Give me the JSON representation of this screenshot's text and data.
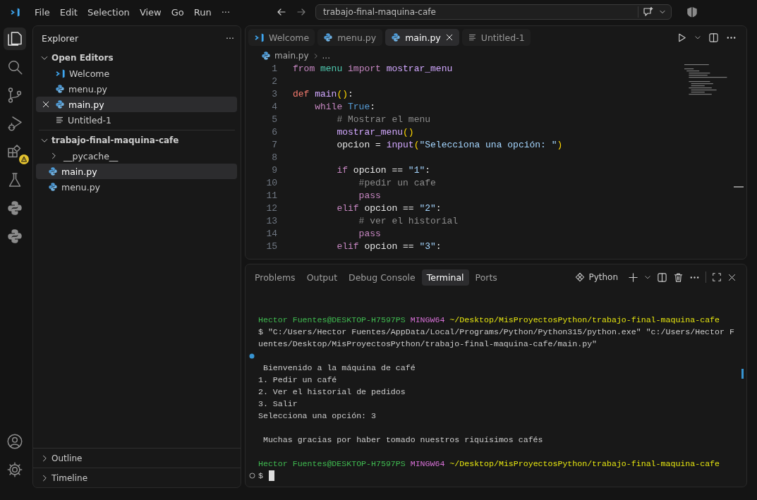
{
  "title_bar": {
    "menu": [
      "File",
      "Edit",
      "Selection",
      "View",
      "Go",
      "Run",
      "···"
    ],
    "command_center": "trabajo-final-maquina-cafe"
  },
  "activity_bar": [
    {
      "kind": "explorer",
      "selected": true,
      "warning": false
    },
    {
      "kind": "search",
      "selected": false,
      "warning": false
    },
    {
      "kind": "source-control",
      "selected": false,
      "warning": false
    },
    {
      "kind": "run-debug",
      "selected": false,
      "warning": false
    },
    {
      "kind": "extensions",
      "selected": false,
      "warning": true
    },
    {
      "kind": "testing",
      "selected": false,
      "warning": false
    },
    {
      "kind": "python",
      "selected": false,
      "warning": false
    },
    {
      "kind": "python",
      "selected": false,
      "warning": false
    }
  ],
  "activity_bar_bottom": [
    {
      "kind": "account"
    },
    {
      "kind": "settings"
    }
  ],
  "explorer": {
    "title": "Explorer",
    "more": "···",
    "sections": [
      {
        "label": "Open Editors",
        "expanded": true,
        "items": [
          {
            "label": "Welcome",
            "kind": "vscode",
            "selected": false
          },
          {
            "label": "menu.py",
            "kind": "python",
            "selected": false
          },
          {
            "label": "main.py",
            "kind": "python",
            "selected": true
          },
          {
            "label": "Untitled-1",
            "kind": "text",
            "selected": false
          }
        ]
      },
      {
        "label": "trabajo-final-maquina-cafe",
        "expanded": true,
        "items": [
          {
            "label": "__pycache__",
            "kind": "folder",
            "selected": false
          },
          {
            "label": "main.py",
            "kind": "python",
            "selected": true
          },
          {
            "label": "menu.py",
            "kind": "python",
            "selected": false
          }
        ]
      },
      {
        "label": "Outline",
        "expanded": false
      },
      {
        "label": "Timeline",
        "expanded": false
      }
    ]
  },
  "editor": {
    "tabs": [
      {
        "label": "Welcome",
        "kind": "vscode",
        "selected": false
      },
      {
        "label": "menu.py",
        "kind": "python",
        "selected": false
      },
      {
        "label": "main.py",
        "kind": "python",
        "selected": true
      },
      {
        "label": "Untitled-1",
        "kind": "text",
        "selected": false
      }
    ],
    "breadcrumb": [
      "main.py",
      "..."
    ],
    "lines": [
      {
        "number": "1",
        "tokens": [
          {
            "kind": "keyword",
            "text": "from "
          },
          {
            "kind": "module",
            "text": "menu "
          },
          {
            "kind": "keyword",
            "text": "import "
          },
          {
            "kind": "function",
            "text": "mostrar_menu"
          }
        ]
      },
      {
        "number": "2"
      },
      {
        "number": "3",
        "tokens": [
          {
            "kind": "def",
            "text": "def "
          },
          {
            "kind": "function",
            "text": "main"
          },
          {
            "kind": "paren",
            "text": "()"
          },
          {
            "kind": "plain",
            "text": ":"
          }
        ]
      },
      {
        "number": "4",
        "tokens": [
          {
            "kind": "keyword",
            "text": "    while "
          },
          {
            "kind": "constant",
            "text": "True"
          },
          {
            "kind": "plain",
            "text": ":"
          }
        ]
      },
      {
        "number": "5",
        "tokens": [
          {
            "kind": "comment",
            "text": "        # Mostrar el menu"
          }
        ]
      },
      {
        "number": "6",
        "tokens": [
          {
            "kind": "function",
            "text": "        mostrar_menu"
          },
          {
            "kind": "paren",
            "text": "()"
          }
        ]
      },
      {
        "number": "7",
        "tokens": [
          {
            "kind": "variable",
            "text": "        opcion = "
          },
          {
            "kind": "function",
            "text": "input"
          },
          {
            "kind": "paren",
            "text": "("
          },
          {
            "kind": "string",
            "text": "\"Selecciona una opción: \""
          },
          {
            "kind": "paren",
            "text": ")"
          }
        ]
      },
      {
        "number": "8"
      },
      {
        "number": "9",
        "tokens": [
          {
            "kind": "keyword",
            "text": "        if "
          },
          {
            "kind": "variable",
            "text": "opcion == "
          },
          {
            "kind": "string",
            "text": "\"1\""
          },
          {
            "kind": "plain",
            "text": ":"
          }
        ]
      },
      {
        "number": "10",
        "tokens": [
          {
            "kind": "comment",
            "text": "            #pedir un cafe"
          }
        ]
      },
      {
        "number": "11",
        "tokens": [
          {
            "kind": "keyword",
            "text": "            pass"
          }
        ]
      },
      {
        "number": "12",
        "tokens": [
          {
            "kind": "keyword",
            "text": "        elif "
          },
          {
            "kind": "variable",
            "text": "opcion == "
          },
          {
            "kind": "string",
            "text": "\"2\""
          },
          {
            "kind": "plain",
            "text": ":"
          }
        ]
      },
      {
        "number": "13",
        "tokens": [
          {
            "kind": "comment",
            "text": "            # ver el historial"
          }
        ]
      },
      {
        "number": "14",
        "tokens": [
          {
            "kind": "keyword",
            "text": "            pass"
          }
        ]
      },
      {
        "number": "15",
        "tokens": [
          {
            "kind": "keyword",
            "text": "        elif "
          },
          {
            "kind": "variable",
            "text": "opcion == "
          },
          {
            "kind": "string",
            "text": "\"3\""
          },
          {
            "kind": "plain",
            "text": ":"
          }
        ]
      }
    ]
  },
  "panel": {
    "tabs": [
      {
        "label": "Problems",
        "selected": false
      },
      {
        "label": "Output",
        "selected": false
      },
      {
        "label": "Debug Console",
        "selected": false
      },
      {
        "label": "Terminal",
        "selected": true
      },
      {
        "label": "Ports",
        "selected": false
      }
    ],
    "terminal_profile": "Python",
    "terminal_lines": [
      {
        "kind": "text",
        "segments": [
          {
            "kind": "user",
            "text": "Hector Fuentes@DESKTOP-H7597PS "
          },
          {
            "kind": "shell",
            "text": "MINGW64 "
          },
          {
            "kind": "path",
            "text": "~/Desktop/MisProyectosPython/trabajo-final-maquina-cafe"
          }
        ]
      },
      {
        "kind": "text",
        "segments": [
          {
            "kind": "plain",
            "text": "$ \"C:/Users/Hector Fuentes/AppData/Local/Programs/Python/Python315/python.exe\" \"c:/Users/Hector F"
          }
        ]
      },
      {
        "kind": "text",
        "segments": [
          {
            "kind": "plain",
            "text": "uentes/Desktop/MisProyectosPython/trabajo-final-maquina-cafe/main.py\""
          }
        ]
      },
      {
        "kind": "blank",
        "succeeded": true
      },
      {
        "kind": "text",
        "segments": [
          {
            "kind": "plain",
            "text": " Bienvenido a la máquina de café"
          }
        ]
      },
      {
        "kind": "text",
        "segments": [
          {
            "kind": "plain",
            "text": "1. Pedir un café"
          }
        ]
      },
      {
        "kind": "text",
        "segments": [
          {
            "kind": "plain",
            "text": "2. Ver el historial de pedidos"
          }
        ]
      },
      {
        "kind": "text",
        "segments": [
          {
            "kind": "plain",
            "text": "3. Salir"
          }
        ]
      },
      {
        "kind": "text",
        "segments": [
          {
            "kind": "plain",
            "text": "Selecciona una opción: 3"
          }
        ]
      },
      {
        "kind": "blank"
      },
      {
        "kind": "text",
        "segments": [
          {
            "kind": "plain",
            "text": " Muchas gracias por haber tomado nuestros riquísimos cafés"
          }
        ]
      },
      {
        "kind": "blank"
      },
      {
        "kind": "text",
        "segments": [
          {
            "kind": "user",
            "text": "Hector Fuentes@DESKTOP-H7597PS "
          },
          {
            "kind": "shell",
            "text": "MINGW64 "
          },
          {
            "kind": "path",
            "text": "~/Desktop/MisProyectosPython/trabajo-final-maquina-cafe"
          }
        ]
      },
      {
        "kind": "text",
        "running": true,
        "cursor": true,
        "segments": [
          {
            "kind": "plain",
            "text": "$"
          }
        ]
      }
    ]
  }
}
